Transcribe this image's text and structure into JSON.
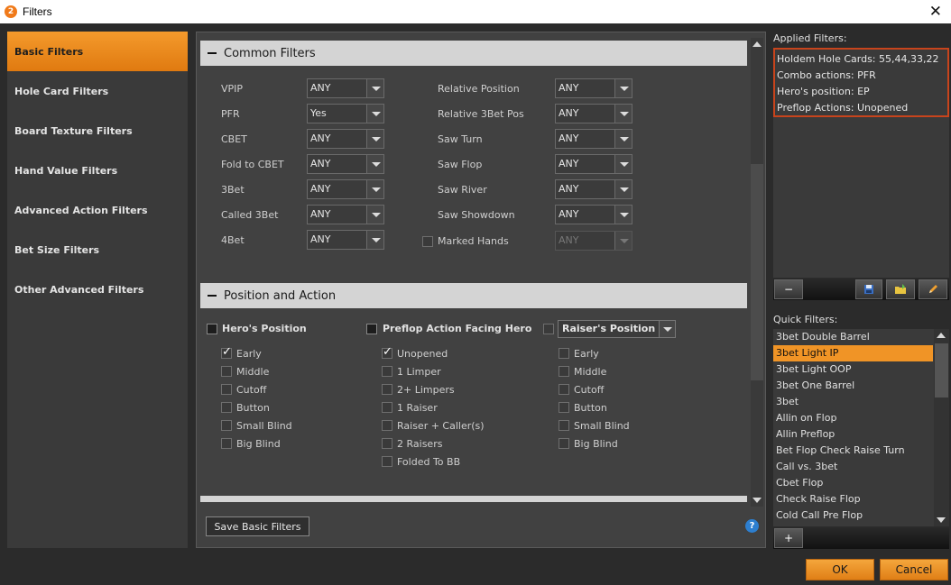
{
  "window": {
    "title": "Filters",
    "app_icon_letter": "2"
  },
  "nav": {
    "items": [
      {
        "label": "Basic Filters",
        "active": true
      },
      {
        "label": "Hole Card Filters"
      },
      {
        "label": "Board Texture Filters"
      },
      {
        "label": "Hand Value Filters"
      },
      {
        "label": "Advanced Action Filters"
      },
      {
        "label": "Bet Size Filters"
      },
      {
        "label": "Other Advanced Filters"
      }
    ]
  },
  "common": {
    "title": "Common Filters",
    "left": [
      {
        "label": "VPIP",
        "value": "ANY"
      },
      {
        "label": "PFR",
        "value": "Yes"
      },
      {
        "label": "CBET",
        "value": "ANY"
      },
      {
        "label": "Fold to CBET",
        "value": "ANY"
      },
      {
        "label": "3Bet",
        "value": "ANY"
      },
      {
        "label": "Called 3Bet",
        "value": "ANY"
      },
      {
        "label": "4Bet",
        "value": "ANY"
      }
    ],
    "right": [
      {
        "label": "Relative Position",
        "value": "ANY"
      },
      {
        "label": "Relative 3Bet Pos",
        "value": "ANY"
      },
      {
        "label": "Saw Turn",
        "value": "ANY"
      },
      {
        "label": "Saw Flop",
        "value": "ANY"
      },
      {
        "label": "Saw River",
        "value": "ANY"
      },
      {
        "label": "Saw Showdown",
        "value": "ANY"
      }
    ],
    "marked": {
      "label": "Marked Hands",
      "value": "ANY"
    }
  },
  "position": {
    "title": "Position and Action",
    "col1": {
      "header": "Hero's Position",
      "items": [
        {
          "label": "Early",
          "checked": true
        },
        {
          "label": "Middle"
        },
        {
          "label": "Cutoff"
        },
        {
          "label": "Button"
        },
        {
          "label": "Small Blind"
        },
        {
          "label": "Big Blind"
        }
      ]
    },
    "col2": {
      "header": "Preflop Action Facing Hero",
      "items": [
        {
          "label": "Unopened",
          "checked": true
        },
        {
          "label": "1 Limper"
        },
        {
          "label": "2+ Limpers"
        },
        {
          "label": "1 Raiser"
        },
        {
          "label": "Raiser + Caller(s)"
        },
        {
          "label": "2 Raisers"
        },
        {
          "label": "Folded To BB"
        }
      ]
    },
    "col3": {
      "header": "Raiser's Position",
      "items": [
        {
          "label": "Early"
        },
        {
          "label": "Middle"
        },
        {
          "label": "Cutoff"
        },
        {
          "label": "Button"
        },
        {
          "label": "Small Blind"
        },
        {
          "label": "Big Blind"
        }
      ]
    }
  },
  "save_button": "Save Basic Filters",
  "help_icon": "?",
  "applied": {
    "label": "Applied Filters:",
    "lines": [
      "Holdem Hole Cards: 55,44,33,22",
      "Combo actions: PFR",
      "Hero's position: EP",
      "Preflop Actions: Unopened"
    ]
  },
  "quick": {
    "label": "Quick Filters:",
    "items": [
      {
        "label": "3bet Double Barrel"
      },
      {
        "label": "3bet Light IP",
        "active": true
      },
      {
        "label": "3bet Light OOP"
      },
      {
        "label": "3bet One Barrel"
      },
      {
        "label": "3bet"
      },
      {
        "label": "Allin on Flop"
      },
      {
        "label": "Allin Preflop"
      },
      {
        "label": "Bet Flop Check Raise Turn"
      },
      {
        "label": "Call vs. 3bet"
      },
      {
        "label": "Cbet Flop"
      },
      {
        "label": "Check Raise Flop"
      },
      {
        "label": "Cold Call Pre Flop"
      }
    ]
  },
  "buttons": {
    "ok": "OK",
    "cancel": "Cancel"
  },
  "colors": {
    "accent": "#f09426",
    "applied_border": "#c8441c",
    "help": "#2d7fd0"
  },
  "icons": {
    "remove": "minus-icon",
    "save": "floppy-disk-icon",
    "load": "folder-icon",
    "edit": "pencil-icon",
    "add": "plus-icon"
  }
}
